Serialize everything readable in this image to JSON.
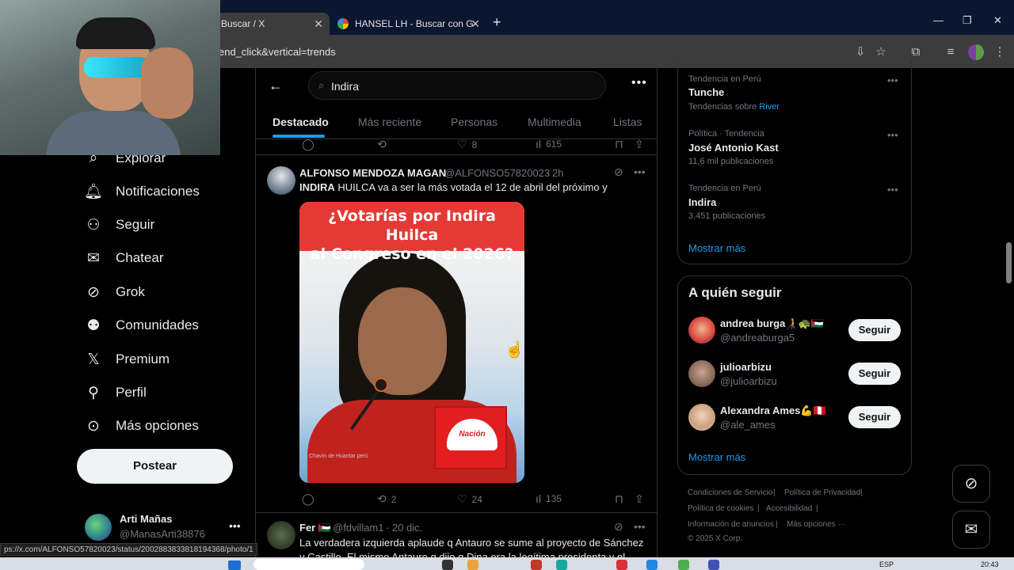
{
  "browser": {
    "tabs": [
      {
        "title": "Buscar / X"
      },
      {
        "title": "HANSEL LH - Buscar con Googl"
      }
    ],
    "url": "end_click&vertical=trends",
    "status_url": "ps://x.com/ALFONSO57820023/status/2002883833818194368/photo/1"
  },
  "nav": {
    "items": [
      {
        "label": "Explorar",
        "icon": "search-icon"
      },
      {
        "label": "Notificaciones",
        "icon": "bell-icon"
      },
      {
        "label": "Seguir",
        "icon": "person-add-icon"
      },
      {
        "label": "Chatear",
        "icon": "envelope-icon"
      },
      {
        "label": "Grok",
        "icon": "grok-icon"
      },
      {
        "label": "Comunidades",
        "icon": "people-icon"
      },
      {
        "label": "Premium",
        "icon": "x-logo-icon"
      },
      {
        "label": "Perfil",
        "icon": "person-icon"
      },
      {
        "label": "Más opciones",
        "icon": "more-circle-icon"
      }
    ],
    "post_label": "Postear",
    "account": {
      "name": "Arti Mañas",
      "handle": "@ManasArti38876"
    }
  },
  "search": {
    "value": "Indira"
  },
  "tabs": [
    "Destacado",
    "Más reciente",
    "Personas",
    "Multimedia",
    "Listas"
  ],
  "prev_tweet_actions": {
    "likes": "8",
    "views": "615"
  },
  "tweets": [
    {
      "name": "ALFONSO MENDOZA MAGAN",
      "handle": "@ALFONSO57820023",
      "time": "· 2h",
      "text_bold": "INDIRA",
      "text_rest": " HUILCA va a ser la más votada el 12 de abril del próximo y",
      "media": {
        "headline_line1": "¿Votarías por Indira Huilca",
        "headline_line2": "al Congreso en el 2026?",
        "logo_text": "Nación",
        "watermark": "Chavín de Huantar perú"
      },
      "retweets": "2",
      "likes": "24",
      "views": "135"
    },
    {
      "name": "Fer 🇵🇸",
      "handle": "@fdvillam1",
      "time": "· 20 dic.",
      "text": "La verdadera izquierda aplaude q Antauro se sume al proyecto de Sánchez y Castillo. El mismo Antauro q dijo q Dina era la legítima presidenta y el"
    }
  ],
  "trends": [
    {
      "meta": "Tendencia en Perú",
      "title": "Tunche",
      "sub_prefix": "Tendencias sobre ",
      "sub_link": "River"
    },
    {
      "meta": "Política · Tendencia",
      "title": "José Antonio Kast",
      "sub": "11,6 mil publicaciones"
    },
    {
      "meta": "Tendencia en Perú",
      "title": "Indira",
      "sub": "3.451 publicaciones"
    }
  ],
  "trends_show_more": "Mostrar más",
  "who_to_follow": {
    "title": "A quién seguir",
    "users": [
      {
        "name": "andrea burga🧑‍🦯🐢🇵🇸",
        "handle": "@andreaburga5",
        "button": "Seguir"
      },
      {
        "name": "julioarbizu",
        "handle": "@julioarbizu",
        "button": "Seguir"
      },
      {
        "name": "Alexandra Ames💪🇵🇪",
        "handle": "@ale_ames",
        "button": "Seguir"
      }
    ],
    "show_more": "Mostrar más"
  },
  "footer": {
    "links": [
      "Condiciones de Servicio",
      "Política de Privacidad",
      "Política de cookies",
      "Accesibilidad",
      "Información de anuncios",
      "Más opciones ···"
    ],
    "copyright": "© 2025 X Corp."
  },
  "taskbar": {
    "lang": "ESP",
    "time": "20:43"
  },
  "colors": {
    "accent": "#1d9bf0",
    "background": "#000000",
    "banner_red": "#e53935"
  }
}
